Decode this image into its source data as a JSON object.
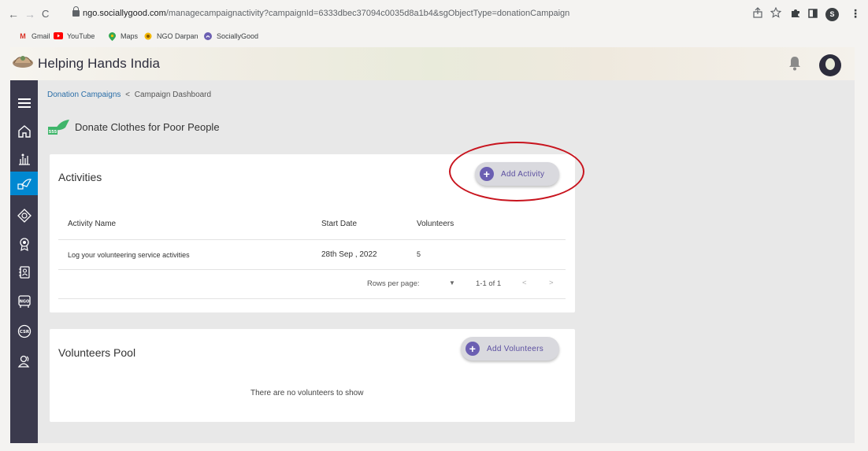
{
  "browser": {
    "back": "←",
    "forward": "→",
    "reload": "C",
    "url_host": "ngo.sociallygood.com",
    "url_path": "/managecampaignactivity?campaignId=6333dbec37094c0035d8a1b4&sgObjectType=donationCampaign",
    "profile_initial": "S",
    "bookmarks": [
      {
        "label": "Gmail",
        "icon": "gmail-icon",
        "color": "#d93025"
      },
      {
        "label": "YouTube",
        "icon": "youtube-icon",
        "color": "#ff0000"
      },
      {
        "label": "Maps",
        "icon": "maps-icon",
        "color": "#34a853"
      },
      {
        "label": "NGO Darpan",
        "icon": "ngo-darpan-icon",
        "color": "#f2b705"
      },
      {
        "label": "SociallyGood",
        "icon": "sociallygood-icon",
        "color": "#6b5fb2"
      }
    ]
  },
  "app": {
    "brand": "Helping Hands India"
  },
  "sidebar": {
    "items": [
      {
        "name": "menu-icon"
      },
      {
        "name": "home-icon"
      },
      {
        "name": "campaigns-icon"
      },
      {
        "name": "donation-campaign-icon",
        "active": true
      },
      {
        "name": "badge-icon"
      },
      {
        "name": "award-icon"
      },
      {
        "name": "contacts-icon"
      },
      {
        "name": "ngo-icon"
      },
      {
        "name": "csr-icon"
      },
      {
        "name": "volunteers-icon"
      }
    ]
  },
  "breadcrumb": {
    "parent": "Donation Campaigns",
    "separator": "<",
    "current": "Campaign Dashboard"
  },
  "page": {
    "title": "Donate Clothes for Poor People"
  },
  "activities": {
    "title": "Activities",
    "add_button": "Add Activity",
    "columns": [
      "Activity Name",
      "Start Date",
      "Volunteers"
    ],
    "rows": [
      {
        "name": "Log your volunteering service activities",
        "start_date": "28th Sep , 2022",
        "volunteers": "5"
      }
    ],
    "pagination": {
      "rows_per_page_label": "Rows per page:",
      "range": "1-1 of 1",
      "prev": "<",
      "next": ">"
    }
  },
  "volunteers_pool": {
    "title": "Volunteers Pool",
    "add_button": "Add Volunteers",
    "empty_message": "There are no volunteers to show"
  },
  "colors": {
    "sidebar": "#3b3a4d",
    "sidebar_active": "#0088d1",
    "accent": "#6b5fb2",
    "annotation": "#c8141e"
  }
}
